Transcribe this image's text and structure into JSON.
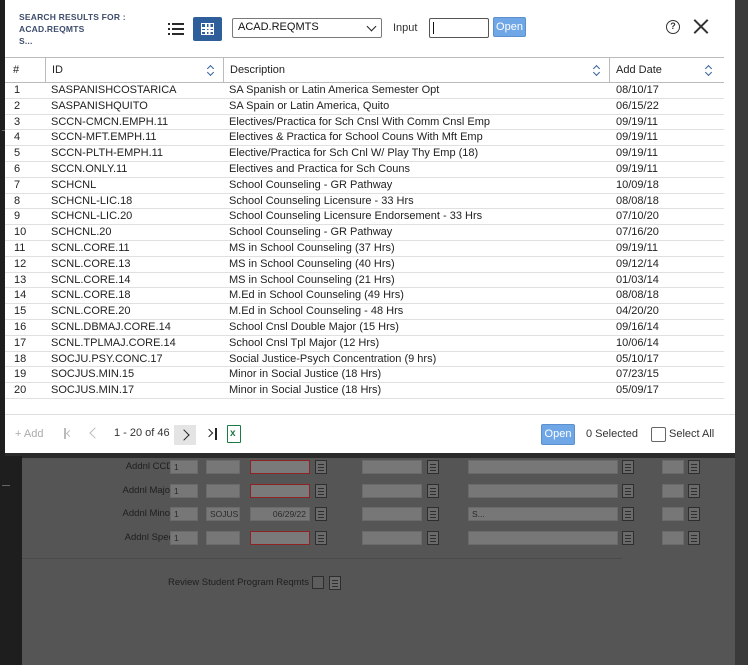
{
  "header": {
    "title_line1": "SEARCH RESULTS FOR :",
    "title_line2": "ACAD.REQMTS",
    "title_line3": "S...",
    "select_value": "ACAD.REQMTS",
    "input_label": "Input",
    "input_value": "",
    "open_label": "Open",
    "help_icon": "?"
  },
  "table": {
    "columns": {
      "num": "#",
      "id": "ID",
      "desc": "Description",
      "date": "Add Date"
    },
    "rows": [
      {
        "n": "1",
        "id": "SASPANISHCOSTARICA",
        "desc": "SA Spanish or Latin America Semester Opt",
        "date": "08/10/17"
      },
      {
        "n": "2",
        "id": "SASPANISHQUITO",
        "desc": "SA Spain or Latin America, Quito",
        "date": "06/15/22"
      },
      {
        "n": "3",
        "id": "SCCN-CMCN.EMPH.11",
        "desc": "Electives/Practica for Sch Cnsl With Comm Cnsl Emp",
        "date": "09/19/11"
      },
      {
        "n": "4",
        "id": "SCCN-MFT.EMPH.11",
        "desc": "Electives & Practica for School Couns With Mft Emp",
        "date": "09/19/11"
      },
      {
        "n": "5",
        "id": "SCCN-PLTH-EMPH.11",
        "desc": "Elective/Practica for Sch Cnl W/ Play Thy Emp (18)",
        "date": "09/19/11"
      },
      {
        "n": "6",
        "id": "SCCN.ONLY.11",
        "desc": "Electives and Practica for Sch Couns",
        "date": "09/19/11"
      },
      {
        "n": "7",
        "id": "SCHCNL",
        "desc": "School Counseling - GR Pathway",
        "date": "10/09/18"
      },
      {
        "n": "8",
        "id": "SCHCNL-LIC.18",
        "desc": "School Counseling Licensure - 33 Hrs",
        "date": "08/08/18"
      },
      {
        "n": "9",
        "id": "SCHCNL-LIC.20",
        "desc": "School Counseling Licensure Endorsement - 33 Hrs",
        "date": "07/10/20"
      },
      {
        "n": "10",
        "id": "SCHCNL.20",
        "desc": "School Counseling - GR Pathway",
        "date": "07/16/20"
      },
      {
        "n": "11",
        "id": "SCNL.CORE.11",
        "desc": "MS in School Counseling (37 Hrs)",
        "date": "09/19/11"
      },
      {
        "n": "12",
        "id": "SCNL.CORE.13",
        "desc": "MS in School Counseling (40 Hrs)",
        "date": "09/12/14"
      },
      {
        "n": "13",
        "id": "SCNL.CORE.14",
        "desc": "MS in School Counseling (21 Hrs)",
        "date": "01/03/14"
      },
      {
        "n": "14",
        "id": "SCNL.CORE.18",
        "desc": "M.Ed in School Counseling (49 Hrs)",
        "date": "08/08/18"
      },
      {
        "n": "15",
        "id": "SCNL.CORE.20",
        "desc": "M.Ed in School Counseling - 48 Hrs",
        "date": "04/20/20"
      },
      {
        "n": "16",
        "id": "SCNL.DBMAJ.CORE.14",
        "desc": "School Cnsl Double Major (15 Hrs)",
        "date": "09/16/14"
      },
      {
        "n": "17",
        "id": "SCNL.TPLMAJ.CORE.14",
        "desc": "School Cnsl Tpl Major (12 Hrs)",
        "date": "10/06/14"
      },
      {
        "n": "18",
        "id": "SOCJU.PSY.CONC.17",
        "desc": "Social Justice-Psych Concentration (9 hrs)",
        "date": "05/10/17"
      },
      {
        "n": "19",
        "id": "SOCJUS.MIN.15",
        "desc": "Minor in Social Justice (18 Hrs)",
        "date": "07/23/15"
      },
      {
        "n": "20",
        "id": "SOCJUS.MIN.17",
        "desc": "Minor in Social Justice (18 Hrs)",
        "date": "05/09/17"
      }
    ]
  },
  "footer": {
    "add_label": "+ Add",
    "range": "1 - 20 of 46",
    "open_label": "Open",
    "selected": "0 Selected",
    "select_all": "Select All",
    "excel_glyph": "x"
  },
  "background": {
    "rows": [
      {
        "label": "Addnl CCDs",
        "num": "1",
        "code": "",
        "date": "",
        "text": ""
      },
      {
        "label": "Addnl Majors",
        "num": "1",
        "code": "",
        "date": "",
        "text": ""
      },
      {
        "label": "Addnl Minors",
        "num": "1",
        "code": "SOJUS",
        "date": "06/29/22",
        "text": "S..."
      },
      {
        "label": "Addnl Specs",
        "num": "1",
        "code": "",
        "date": "",
        "text": ""
      }
    ],
    "review_label": "Review Student Program Reqmts"
  },
  "colors": {
    "accent": "#2f5f9a",
    "open_button": "#6fa6e6",
    "excel_green": "#1e7a45"
  },
  "icons": [
    "list-view-icon",
    "grid-view-icon",
    "chevron-down-icon",
    "help-icon",
    "close-icon",
    "sort-icon",
    "first-page-icon",
    "prev-page-icon",
    "next-page-icon",
    "last-page-icon",
    "excel-export-icon"
  ]
}
